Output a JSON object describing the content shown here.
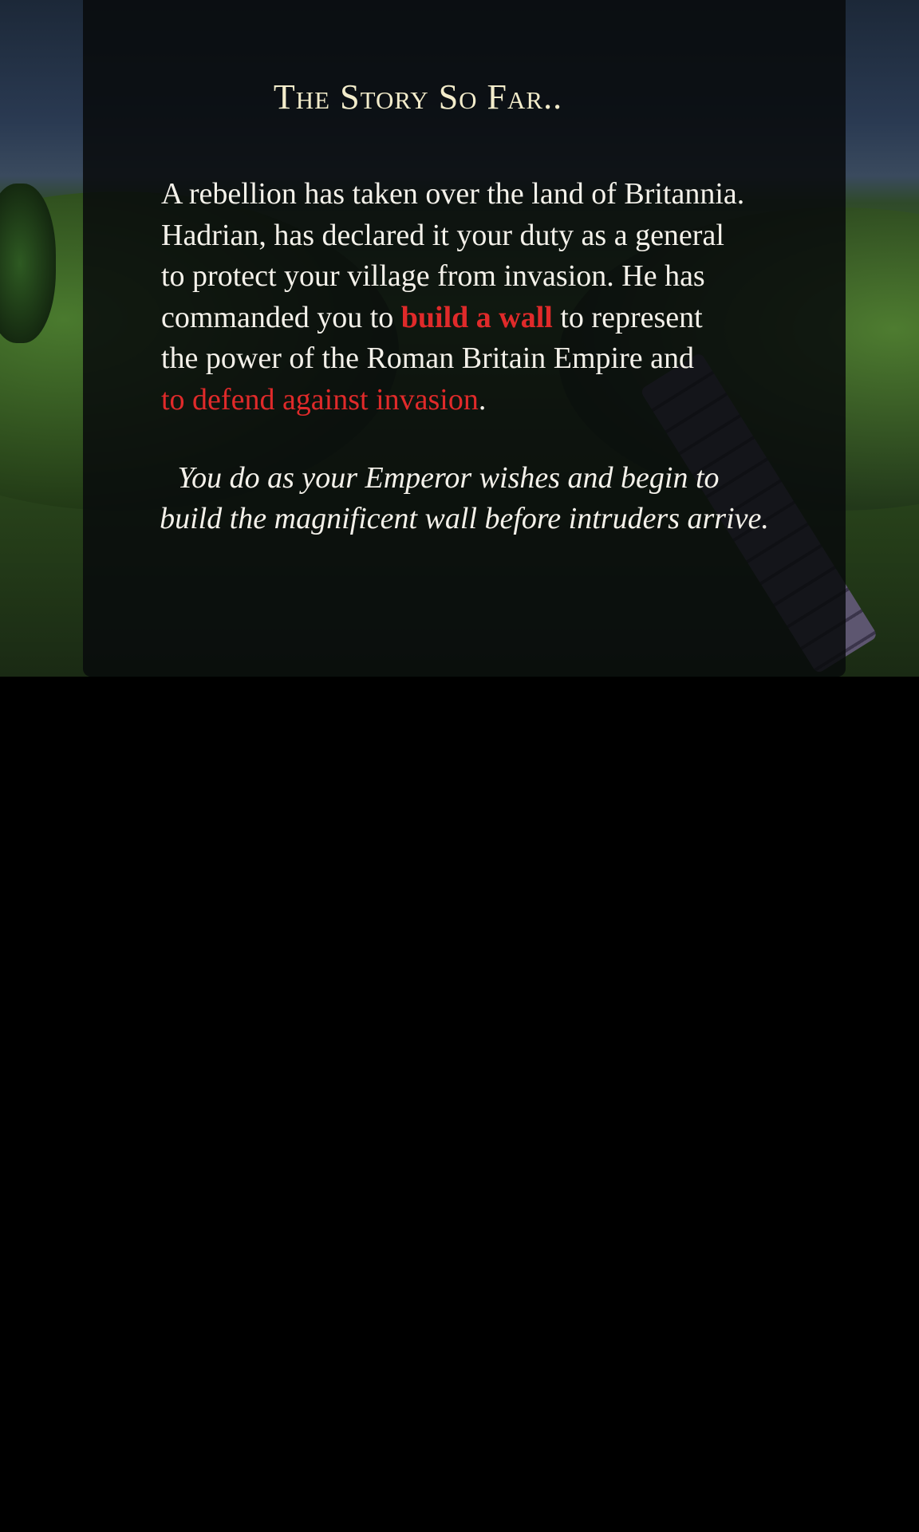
{
  "story": {
    "title": "The Story So Far..",
    "lines": [
      "A rebellion has taken over the land of Britannia.",
      "Hadrian, has declared it your duty as a general",
      "to protect your village from invasion. He has"
    ],
    "line4_pre": "commanded you to ",
    "line4_highlight": "build a wall",
    "line4_post": " to represent",
    "line5": "the power of the Roman Britain Empire and",
    "line6_highlight": "to defend against invasion",
    "line6_post": ".",
    "italic_lines": [
      "You do as your Emperor wishes and begin to",
      "build the magnificent wall before intruders arrive."
    ]
  },
  "colors": {
    "highlight": "#e02a2a",
    "title": "#f3eccb"
  }
}
